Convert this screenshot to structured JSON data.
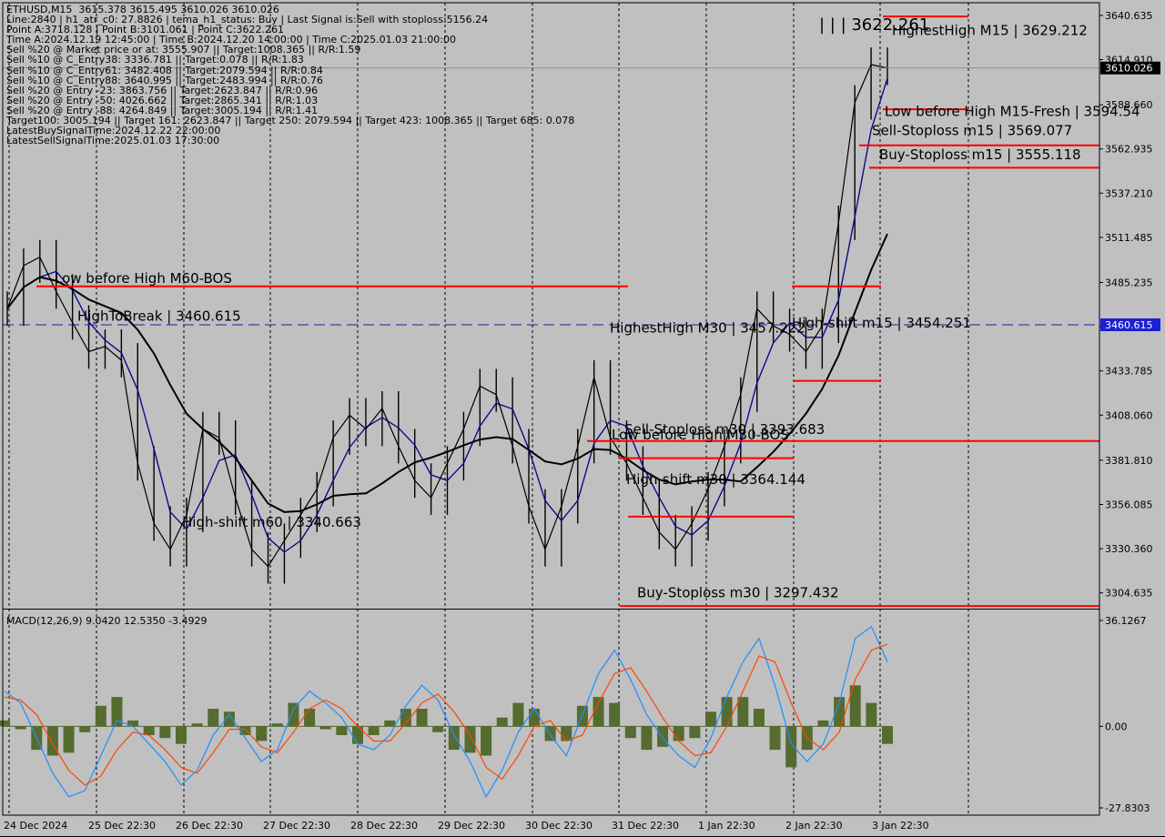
{
  "header": {
    "title": "ETHUSD,M15  3615.378 3615.495 3610.026 3610.026",
    "lines": [
      "Line:2840 | h1_atr_c0: 27.8826 | tema_h1_status: Buy | Last Signal is:Sell with stoploss:5156.24",
      "Point A:3718.128 | Point B:3101.061 | Point C:3622.261",
      "Time A:2024.12.19 12:45:00 | Time B:2024.12.20 14:00:00 | Time C:2025.01.03 21:00:00",
      "Sell %20 @ Market price or at: 3555.907 || Target:1008.365 || R/R:1.59",
      "Sell %10 @ C_Entry38: 3336.781 || Target:0.078 || R/R:1.83",
      "Sell %10 @ C_Entry61: 3482.408 || Target:2079.594 || R/R:0.84",
      "Sell %10 @ C_Entry88: 3640.995 || Target:2483.994 || R/R:0.76",
      "Sell %20 @ Entry -23: 3863.756 || Target:2623.847 || R/R:0.96",
      "Sell %20 @ Entry -50: 4026.662 || Target:2865.341 || R/R:1.03",
      "Sell %20 @ Entry -88: 4264.849 || Target:3005.194 || R/R:1.41",
      "Target100: 3005.194 || Target 161: 2623.847 || Target 250: 2079.594 || Target 423: 1008.365 || Target 685: 0.078",
      "LatestBuySignalTime:2024.12.22 22:00:00",
      "LatestSellSignalTime:2025.01.03 17:30:00"
    ]
  },
  "colors": {
    "background": "#c0c0c0",
    "price": "#000000",
    "blue_ma": "#0a0a8c",
    "black_ma": "#000000",
    "red_level": "#ff0000",
    "dashed_blue": "#1e1e9b",
    "orange": "#ff6a00",
    "macd_hist": "#556b2f",
    "macd_main": "#1e90ff",
    "macd_signal": "#ff4500",
    "price_tag": "#000000",
    "level_tag": "#1e1ed2"
  },
  "chart_data": [
    {
      "type": "line",
      "name": "price",
      "y_ticks": [
        "3640.635",
        "3614.910",
        "3588.660",
        "3562.935",
        "3537.210",
        "3511.485",
        "3485.235",
        "3459.510",
        "3433.785",
        "3408.060",
        "3381.810",
        "3356.085",
        "3330.360",
        "3304.635"
      ],
      "ylim": [
        3296,
        3648
      ],
      "x_ticks": [
        "24 Dec 2024",
        "25 Dec 22:30",
        "26 Dec 22:30",
        "27 Dec 22:30",
        "28 Dec 22:30",
        "29 Dec 22:30",
        "30 Dec 22:30",
        "31 Dec 22:30",
        "1 Jan 22:30",
        "2 Jan 22:30",
        "3 Jan 22:30"
      ],
      "x": [
        0,
        1,
        2,
        3,
        4,
        5,
        6,
        7,
        8,
        9,
        10
      ],
      "close_series": [
        3470,
        3495,
        3500,
        3480,
        3462,
        3445,
        3448,
        3440,
        3380,
        3345,
        3330,
        3350,
        3400,
        3395,
        3360,
        3330,
        3320,
        3335,
        3350,
        3365,
        3395,
        3408,
        3400,
        3412,
        3390,
        3370,
        3360,
        3380,
        3400,
        3425,
        3420,
        3390,
        3355,
        3330,
        3355,
        3390,
        3430,
        3395,
        3380,
        3360,
        3340,
        3330,
        3345,
        3365,
        3390,
        3420,
        3470,
        3460,
        3455,
        3445,
        3460,
        3520,
        3590,
        3612,
        3610
      ],
      "current_price": "3610.026",
      "current_price_tag": "3610.026",
      "dashed_level": "3460.615",
      "dashed_level_tag": "3460.615",
      "labels": [
        {
          "text": "| | | 3622.261",
          "price": 3632
        },
        {
          "text": "HighestHigh   M15 | 3629.212",
          "price": 3629.2
        },
        {
          "text": "Low before High   M15-Fresh | 3594.54",
          "price": 3582
        },
        {
          "text": "Sell-Stoploss m15 | 3569.077",
          "price": 3571
        },
        {
          "text": "Buy-Stoploss m15 | 3555.118",
          "price": 3557
        },
        {
          "text": "Low before High   M60-BOS",
          "price": 3485
        },
        {
          "text": "HighToBreak | 3460.615",
          "price": 3463
        },
        {
          "text": "HighestHigh   M30 | 3457.222",
          "price": 3456
        },
        {
          "text": "High-shift m15 | 3454.251",
          "price": 3459
        },
        {
          "text": "Sell-Stoploss m30 | 3393.683",
          "price": 3397
        },
        {
          "text": "Low before High   M30-BOS",
          "price": 3394
        },
        {
          "text": "High-shift m30 | 3364.144",
          "price": 3368
        },
        {
          "text": "High-shift m60 | 3340.663",
          "price": 3343
        },
        {
          "text": "Buy-Stoploss m30 | 3297.432",
          "price": 3302
        }
      ]
    },
    {
      "type": "bar",
      "name": "MACD(12,26,9) 9.0420 12.5350 -3.4929",
      "title": "MACD(12,26,9) 9.0420 12.5350 -3.4929",
      "y_ticks": [
        "36.1267",
        "0.00",
        "-27.8303"
      ],
      "ylim": [
        -27.8303,
        36.1267
      ],
      "main_series": [
        12,
        8,
        -4,
        -16,
        -24,
        -22,
        -10,
        2,
        0,
        -6,
        -12,
        -20,
        -15,
        -3,
        4,
        -4,
        -12,
        -8,
        6,
        12,
        8,
        3,
        -6,
        -8,
        -3,
        7,
        14,
        9,
        -3,
        -12,
        -24,
        -15,
        -2,
        6,
        -3,
        -10,
        4,
        18,
        26,
        16,
        4,
        -4,
        -10,
        -14,
        -4,
        10,
        22,
        30,
        14,
        -6,
        -12,
        -6,
        8,
        30,
        34,
        22
      ],
      "signal_series": [
        10,
        9,
        4,
        -6,
        -15,
        -20,
        -17,
        -8,
        -2,
        -3,
        -8,
        -14,
        -16,
        -9,
        -1,
        -1,
        -7,
        -9,
        -2,
        6,
        9,
        6,
        0,
        -5,
        -5,
        1,
        8,
        11,
        5,
        -3,
        -14,
        -18,
        -10,
        0,
        2,
        -5,
        -3,
        8,
        18,
        20,
        12,
        3,
        -5,
        -10,
        -9,
        0,
        12,
        24,
        22,
        8,
        -4,
        -8,
        -2,
        16,
        26,
        28
      ]
    }
  ]
}
